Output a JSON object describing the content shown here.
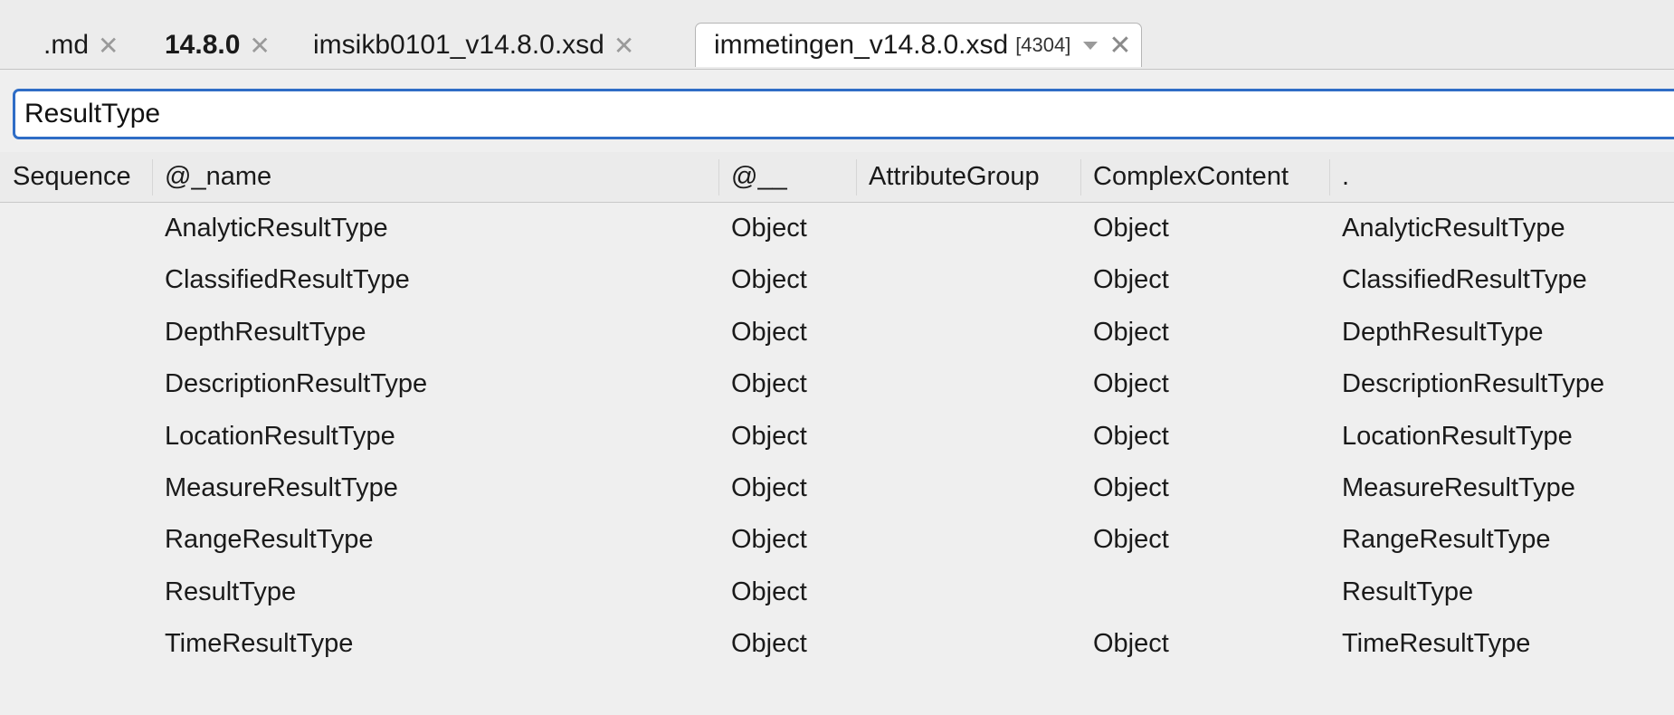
{
  "tabs": [
    {
      "label": ".md",
      "bold": false,
      "active": false
    },
    {
      "label": "14.8.0",
      "bold": true,
      "active": false
    },
    {
      "label": "imsikb0101_v14.8.0.xsd",
      "bold": false,
      "active": false
    },
    {
      "label": "immetingen_v14.8.0.xsd",
      "count": "[4304]",
      "bold": false,
      "active": true
    }
  ],
  "search": {
    "value": "ResultType"
  },
  "table": {
    "columns": [
      "Sequence",
      "@_name",
      "@__",
      "AttributeGroup",
      "ComplexContent",
      "."
    ],
    "rows": [
      {
        "sequence": "",
        "name": "AnalyticResultType",
        "at": "Object",
        "attribute_group": "",
        "complex_content": "Object",
        "dot": "AnalyticResultType"
      },
      {
        "sequence": "",
        "name": "ClassifiedResultType",
        "at": "Object",
        "attribute_group": "",
        "complex_content": "Object",
        "dot": "ClassifiedResultType"
      },
      {
        "sequence": "",
        "name": "DepthResultType",
        "at": "Object",
        "attribute_group": "",
        "complex_content": "Object",
        "dot": "DepthResultType"
      },
      {
        "sequence": "",
        "name": "DescriptionResultType",
        "at": "Object",
        "attribute_group": "",
        "complex_content": "Object",
        "dot": "DescriptionResultType"
      },
      {
        "sequence": "",
        "name": "LocationResultType",
        "at": "Object",
        "attribute_group": "",
        "complex_content": "Object",
        "dot": "LocationResultType"
      },
      {
        "sequence": "",
        "name": "MeasureResultType",
        "at": "Object",
        "attribute_group": "",
        "complex_content": "Object",
        "dot": "MeasureResultType"
      },
      {
        "sequence": "",
        "name": "RangeResultType",
        "at": "Object",
        "attribute_group": "",
        "complex_content": "Object",
        "dot": "RangeResultType"
      },
      {
        "sequence": "",
        "name": "ResultType",
        "at": "Object",
        "attribute_group": "",
        "complex_content": "",
        "dot": "ResultType"
      },
      {
        "sequence": "",
        "name": "TimeResultType",
        "at": "Object",
        "attribute_group": "",
        "complex_content": "Object",
        "dot": "TimeResultType"
      }
    ]
  },
  "icons": {
    "tab_close": "close-icon",
    "tab_dropdown": "chevron-down-icon"
  },
  "colors": {
    "focus_border": "#2f6dc6",
    "background": "#efefef"
  }
}
